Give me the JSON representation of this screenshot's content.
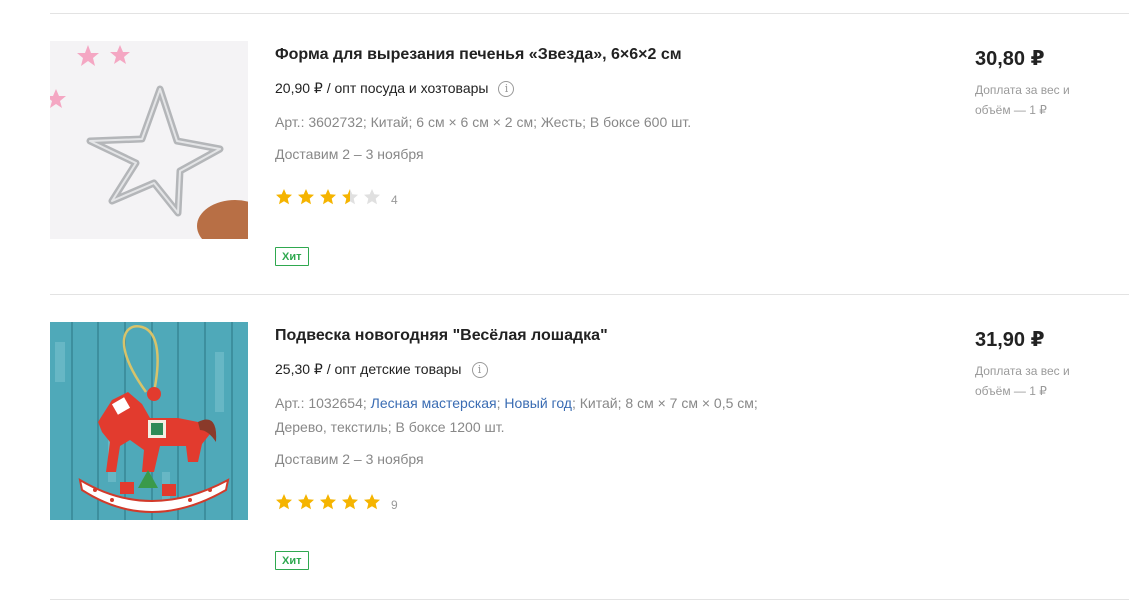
{
  "products": [
    {
      "title": "Форма для вырезания печенья «Звезда», 6×6×2 см",
      "wholesale_price": "20,90 ₽ / опт посуда и хозтовары",
      "info_icon": "i",
      "specs": {
        "article": "Арт.: 3602732;",
        "country": "Китай;",
        "size": "6 см × 6 см × 2 см;",
        "material": "Жесть;",
        "box": "В боксе 600 шт."
      },
      "delivery": "Доставим 2 – 3 ноября",
      "rating": 3.5,
      "reviews_count": "4",
      "badge": "Хит",
      "price": "30,80 ₽",
      "extra_fee": "Доплата за вес и объём — 1 ₽"
    },
    {
      "title": "Подвеска новогодняя \"Весёлая лошадка\"",
      "wholesale_price": "25,30 ₽ / опт детские товары",
      "info_icon": "i",
      "specs": {
        "article": "Арт.: 1032654;",
        "brand": "Лесная мастерская",
        "brand_sep": ";",
        "collection": "Новый год",
        "collection_sep": ";",
        "country": "Китай;",
        "size": "8 см × 7 см × 0,5 см;",
        "material": "Дерево, текстиль;",
        "box": "В боксе 1200 шт."
      },
      "delivery": "Доставим 2 – 3 ноября",
      "rating": 5,
      "reviews_count": "9",
      "badge": "Хит",
      "price": "31,90 ₽",
      "extra_fee": "Доплата за вес и объём — 1 ₽"
    }
  ],
  "colors": {
    "star_filled": "#f5b400",
    "star_empty": "#e0e0e0",
    "badge": "#2fa84f",
    "link": "#3a6cb3"
  }
}
